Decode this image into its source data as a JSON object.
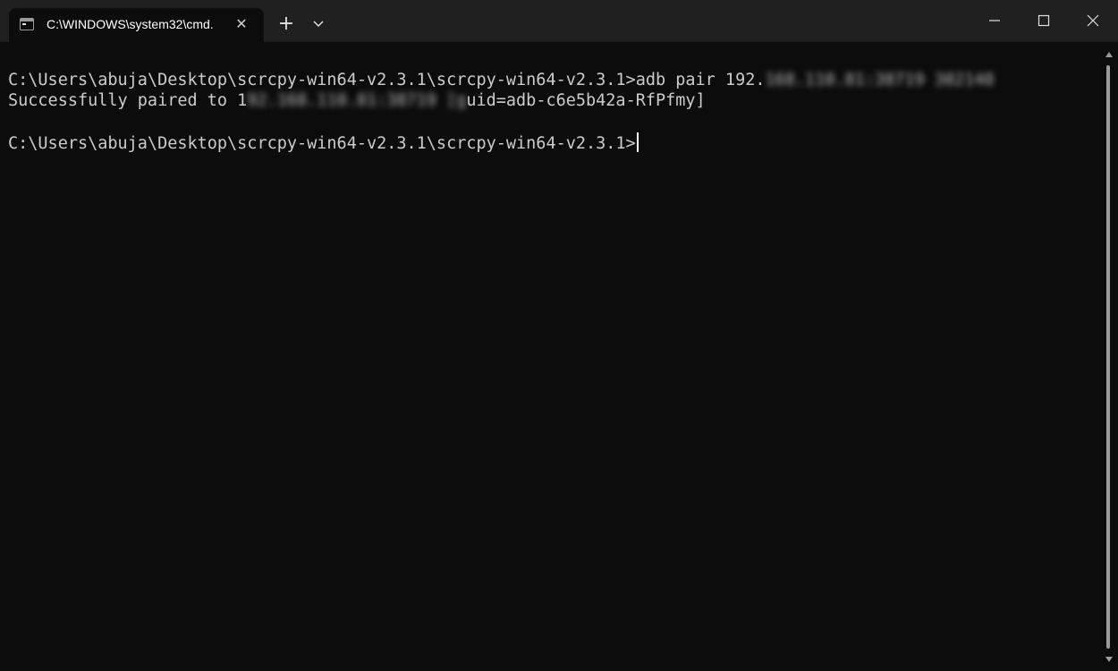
{
  "window": {
    "tab_title": "C:\\WINDOWS\\system32\\cmd.",
    "tab_close_glyph": "✕",
    "new_tab_glyph": "+"
  },
  "terminal": {
    "line1_prefix": "C:\\Users\\abuja\\Desktop\\scrcpy-win64-v2.3.1\\scrcpy-win64-v2.3.1>adb pair 192.",
    "line1_blurred": "168.110.81:38719 302148",
    "line2_prefix": "Successfully paired to 1",
    "line2_blurred": "92.168.110.81:38719 [g",
    "line2_suffix": "uid=adb-c6e5b42a-RfPfmy]",
    "line3_prompt": "C:\\Users\\abuja\\Desktop\\scrcpy-win64-v2.3.1\\scrcpy-win64-v2.3.1>"
  },
  "colors": {
    "titlebar": "#202020",
    "terminal_bg": "#0c0c0c",
    "text": "#cccccc"
  }
}
